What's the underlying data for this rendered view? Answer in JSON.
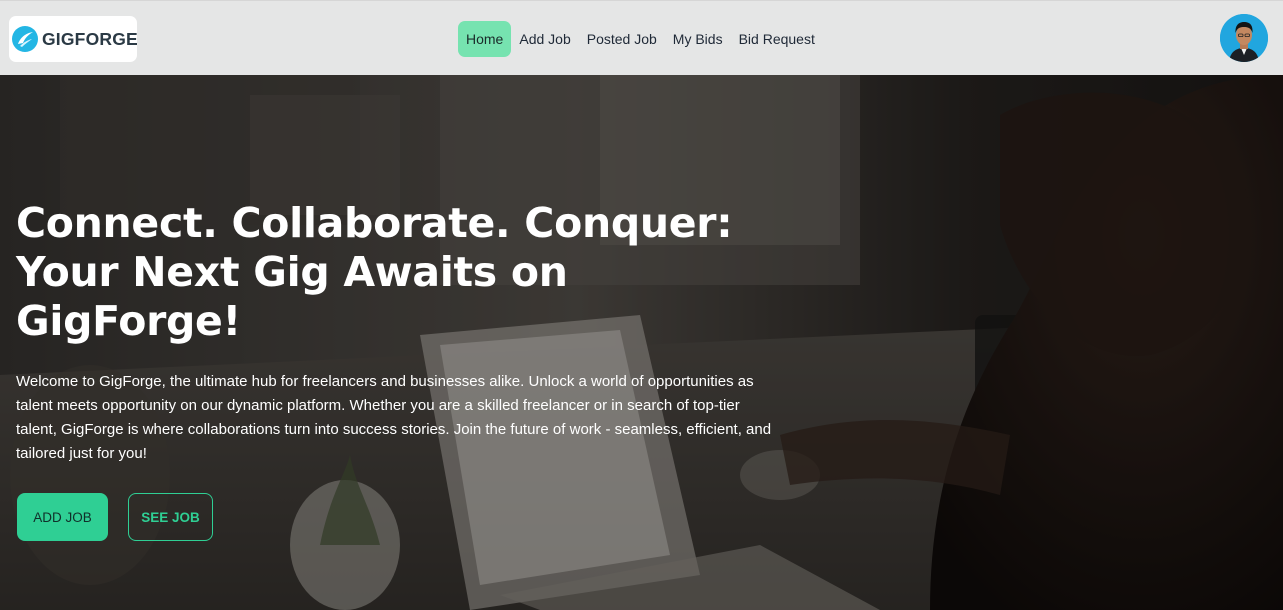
{
  "brand": {
    "name": "GIGFORGE",
    "logo_icon": "gigforge-logo-icon"
  },
  "nav": {
    "items": [
      {
        "label": "Home",
        "active": true
      },
      {
        "label": "Add Job",
        "active": false
      },
      {
        "label": "Posted Job",
        "active": false
      },
      {
        "label": "My Bids",
        "active": false
      },
      {
        "label": "Bid Request",
        "active": false
      }
    ],
    "active_color": "#76e3b0"
  },
  "user": {
    "avatar_icon": "user-avatar"
  },
  "hero": {
    "title": "Connect. Collaborate. Conquer: Your Next Gig Awaits on GigForge!",
    "description": "Welcome to GigForge, the ultimate hub for freelancers and businesses alike. Unlock a world of opportunities as talent meets opportunity on our dynamic platform. Whether you are a skilled freelancer or in search of top-tier talent, GigForge is where collaborations turn into success stories. Join the future of work - seamless, efficient, and tailored just for you!",
    "primary_button": "ADD JOB",
    "secondary_button": "SEE JOB",
    "accent_color": "#2fcf94"
  }
}
